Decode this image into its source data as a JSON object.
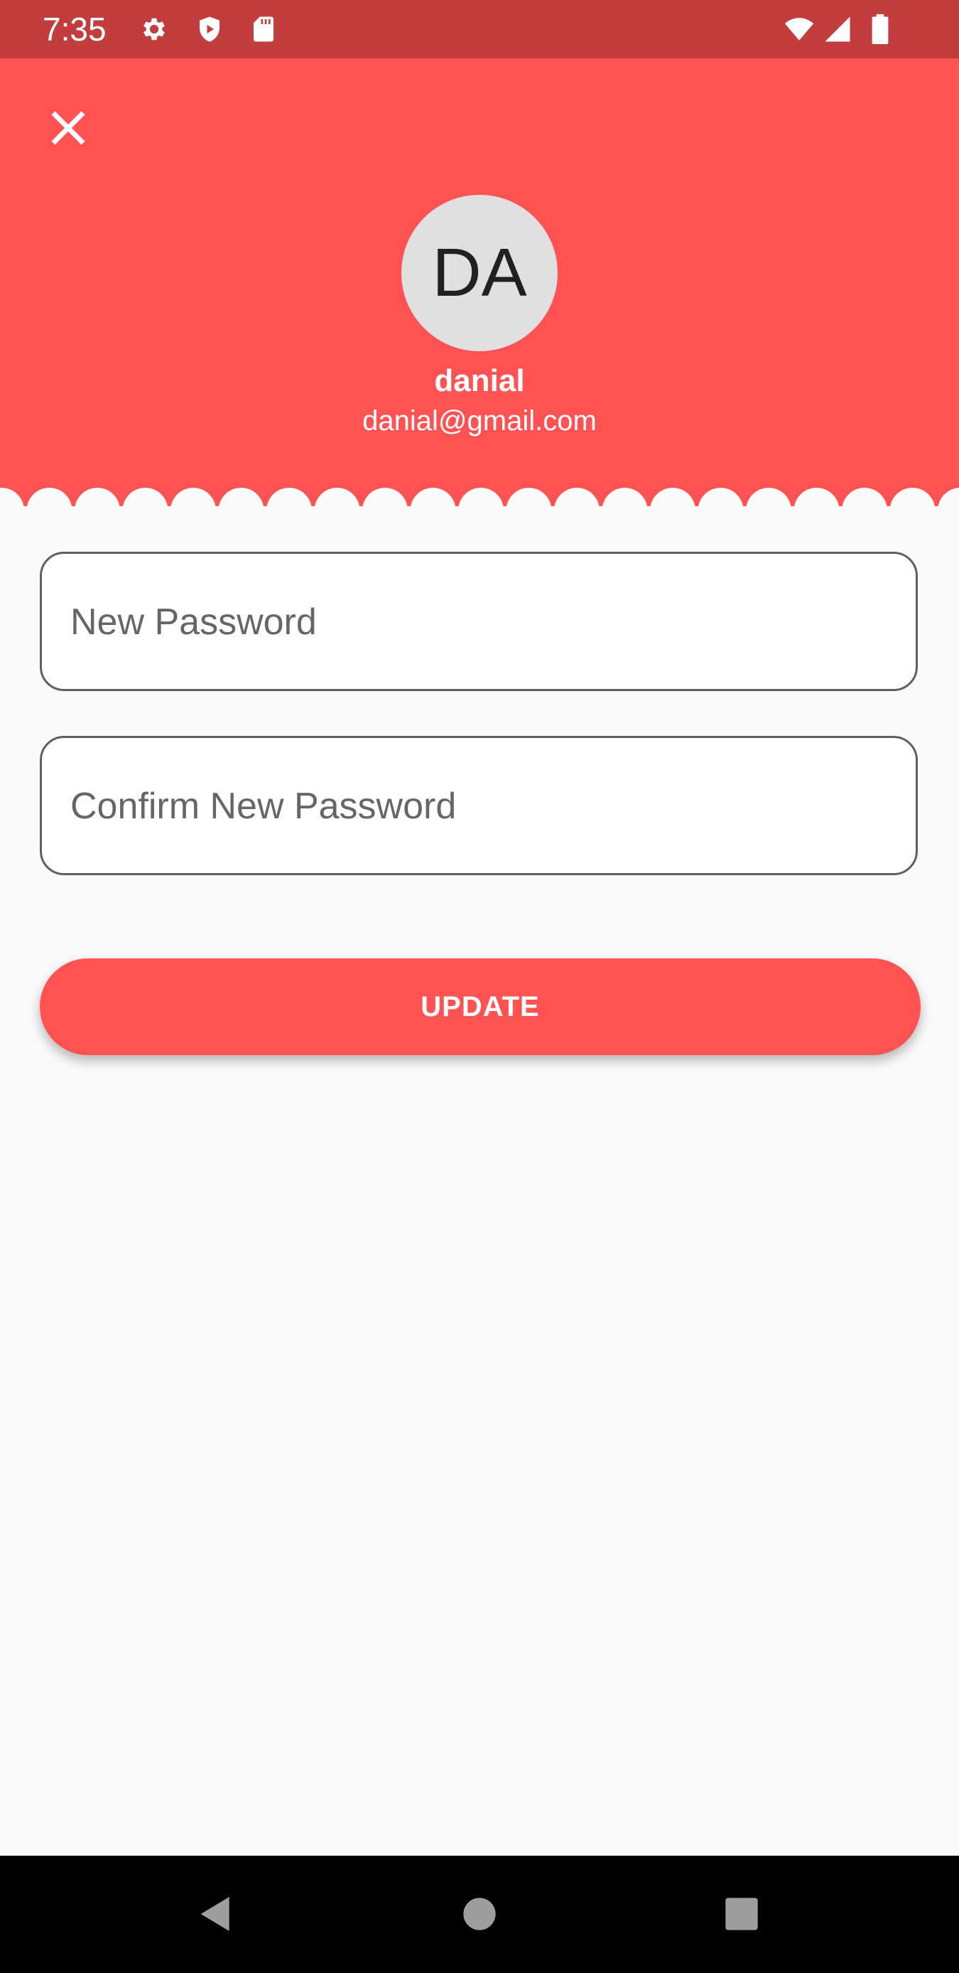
{
  "status_bar": {
    "time": "7:35",
    "icons_left": [
      "gear-icon",
      "shield-play-icon",
      "sd-card-icon"
    ],
    "icons_right": [
      "wifi-icon",
      "signal-icon",
      "battery-icon"
    ]
  },
  "header": {
    "avatar_initials": "DA",
    "user_name": "danial",
    "user_email": "danial@gmail.com",
    "background_color": "#ff5252"
  },
  "form": {
    "new_password": {
      "placeholder": "New Password",
      "value": ""
    },
    "confirm_password": {
      "placeholder": "Confirm New Password",
      "value": ""
    },
    "update_label": "UPDATE"
  },
  "nav_bar": {
    "buttons": [
      "back-icon",
      "home-icon",
      "recents-icon"
    ]
  },
  "colors": {
    "accent": "#ff5252",
    "status_bar": "#c23e3e",
    "background": "#fafafa"
  }
}
